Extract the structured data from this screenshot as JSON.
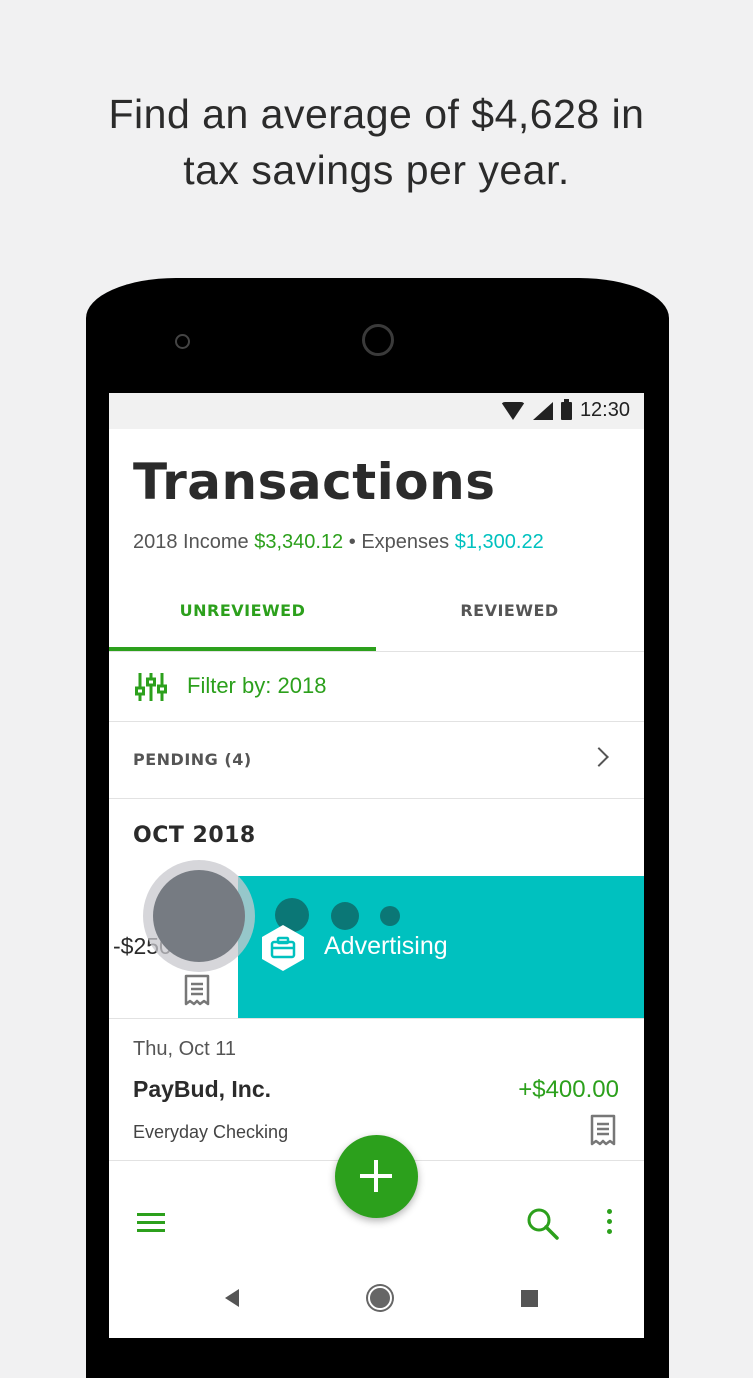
{
  "headline": {
    "line1": "Find an average of $4,628 in",
    "line2": "tax savings per year."
  },
  "status_bar": {
    "time": "12:30"
  },
  "page": {
    "title": "Transactions"
  },
  "summary": {
    "income_label": "2018 Income",
    "income_value": "$3,340.12",
    "separator": "•",
    "expenses_label": "Expenses",
    "expenses_value": "$1,300.22"
  },
  "tabs": [
    {
      "label": "UNREVIEWED",
      "active": true
    },
    {
      "label": "REVIEWED",
      "active": false
    }
  ],
  "filter": {
    "label": "Filter by:",
    "value": "2018"
  },
  "pending": {
    "label": "PENDING (4)"
  },
  "month_header": "OCT 2018",
  "swipe_transaction": {
    "amount": "-$250.00",
    "category": "Advertising",
    "category_icon": "briefcase-icon"
  },
  "transactions": [
    {
      "date": "Thu, Oct 11",
      "name": "PayBud, Inc.",
      "amount": "+$400.00",
      "account": "Everyday Checking"
    }
  ],
  "colors": {
    "brand_green": "#2ca01c",
    "teal": "#00c1bf",
    "text_dark": "#2b2b2b"
  }
}
